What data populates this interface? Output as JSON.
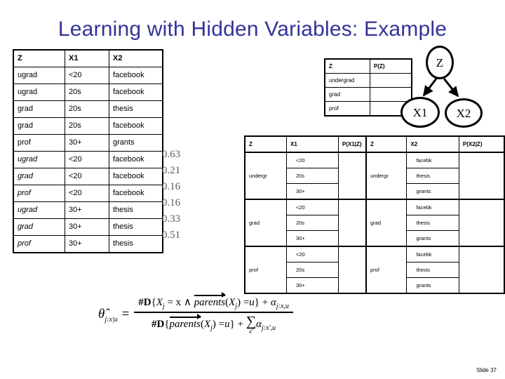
{
  "slide": {
    "title": "Learning with Hidden Variables: Example",
    "number_label": "Slide 37",
    "title_color": "#333399"
  },
  "data_table": {
    "headers": [
      "Z",
      "X1",
      "X2"
    ],
    "rows": [
      {
        "z": "ugrad",
        "x1": "<20",
        "x2": "facebook",
        "inferred": false,
        "prob": ""
      },
      {
        "z": "ugrad",
        "x1": "20s",
        "x2": "facebook",
        "inferred": false,
        "prob": ""
      },
      {
        "z": "grad",
        "x1": "20s",
        "x2": "thesis",
        "inferred": false,
        "prob": ""
      },
      {
        "z": "grad",
        "x1": "20s",
        "x2": "facebook",
        "inferred": false,
        "prob": ""
      },
      {
        "z": "prof",
        "x1": "30+",
        "x2": "grants",
        "inferred": false,
        "prob": ""
      },
      {
        "z": "ugrad",
        "x1": "<20",
        "x2": "facebook",
        "inferred": true,
        "prob": "0.63"
      },
      {
        "z": "grad",
        "x1": "<20",
        "x2": "facebook",
        "inferred": true,
        "prob": "0.21"
      },
      {
        "z": "prof",
        "x1": "<20",
        "x2": "facebook",
        "inferred": true,
        "prob": "0.16"
      },
      {
        "z": "ugrad",
        "x1": "30+",
        "x2": "thesis",
        "inferred": true,
        "prob": "0.16"
      },
      {
        "z": "grad",
        "x1": "30+",
        "x2": "thesis",
        "inferred": true,
        "prob": "0.33"
      },
      {
        "z": "prof",
        "x1": "30+",
        "x2": "thesis",
        "inferred": true,
        "prob": "0.51"
      }
    ]
  },
  "pz_table": {
    "headers": [
      "Z",
      "P(Z)"
    ],
    "rows": [
      {
        "z": "undergrad",
        "p": ""
      },
      {
        "z": "grad",
        "p": ""
      },
      {
        "z": "prof",
        "p": ""
      }
    ]
  },
  "px1z_table": {
    "headers": [
      "Z",
      "X1",
      "P(X1|Z)"
    ],
    "groups": [
      {
        "z": "undergr",
        "values": [
          "<20",
          "20s",
          "30+"
        ],
        "p": ""
      },
      {
        "z": "grad",
        "values": [
          "<20",
          "20s",
          "30+"
        ],
        "p": ""
      },
      {
        "z": "prof",
        "values": [
          "<20",
          "20s",
          "30+"
        ],
        "p": ""
      }
    ]
  },
  "px2z_table": {
    "headers": [
      "Z",
      "X2",
      "P(X2|Z)"
    ],
    "groups": [
      {
        "z": "undergr",
        "values": [
          "facebk",
          "thesis",
          "grants"
        ],
        "p": ""
      },
      {
        "z": "grad",
        "values": [
          "facebk",
          "thesis",
          "grants"
        ],
        "p": ""
      },
      {
        "z": "prof",
        "values": [
          "facebk",
          "thesis",
          "grants"
        ],
        "p": ""
      }
    ]
  },
  "bayes_net": {
    "nodes": [
      {
        "id": "z",
        "label": "Z"
      },
      {
        "id": "x1",
        "label": "X1"
      },
      {
        "id": "x2",
        "label": "X2"
      }
    ],
    "edges": [
      {
        "from": "Z",
        "to": "X1"
      },
      {
        "from": "Z",
        "to": "X2"
      }
    ]
  },
  "formula": {
    "lhs": "θ̂",
    "lhs_sub": "j:x|u",
    "numerator_text": "#D{X_j = x ∧ parents(X_j) = u} + α_{j:x,u}",
    "denominator_text": "#D{parents(X_j) = u} + Σ_{x'} α_{j:x',u}",
    "num_hash": "#",
    "num_d": "D",
    "num_open": "{",
    "num_x": "X",
    "num_x_sub": "j",
    "num_eq": "= x ∧",
    "num_parents": "parents",
    "num_parents_arg_open": "(",
    "num_parents_x": "X",
    "num_parents_x_sub": "j",
    "num_parents_arg_close": ")",
    "num_eq2": "=",
    "num_u": "u",
    "num_close": "}",
    "num_plus": "+",
    "num_alpha": "α",
    "num_alpha_sub": "j:x,u",
    "den_hash": "#",
    "den_d": "D",
    "den_open": "{",
    "den_parents": "parents",
    "den_arg_open": "(",
    "den_x": "X",
    "den_x_sub": "j",
    "den_arg_close": ")",
    "den_eq": "=",
    "den_u": "u",
    "den_close": "}",
    "den_plus": "+",
    "den_sigma": "∑",
    "den_sigma_lim": "x'",
    "den_alpha": "α",
    "den_alpha_sub": "j:x',u"
  }
}
